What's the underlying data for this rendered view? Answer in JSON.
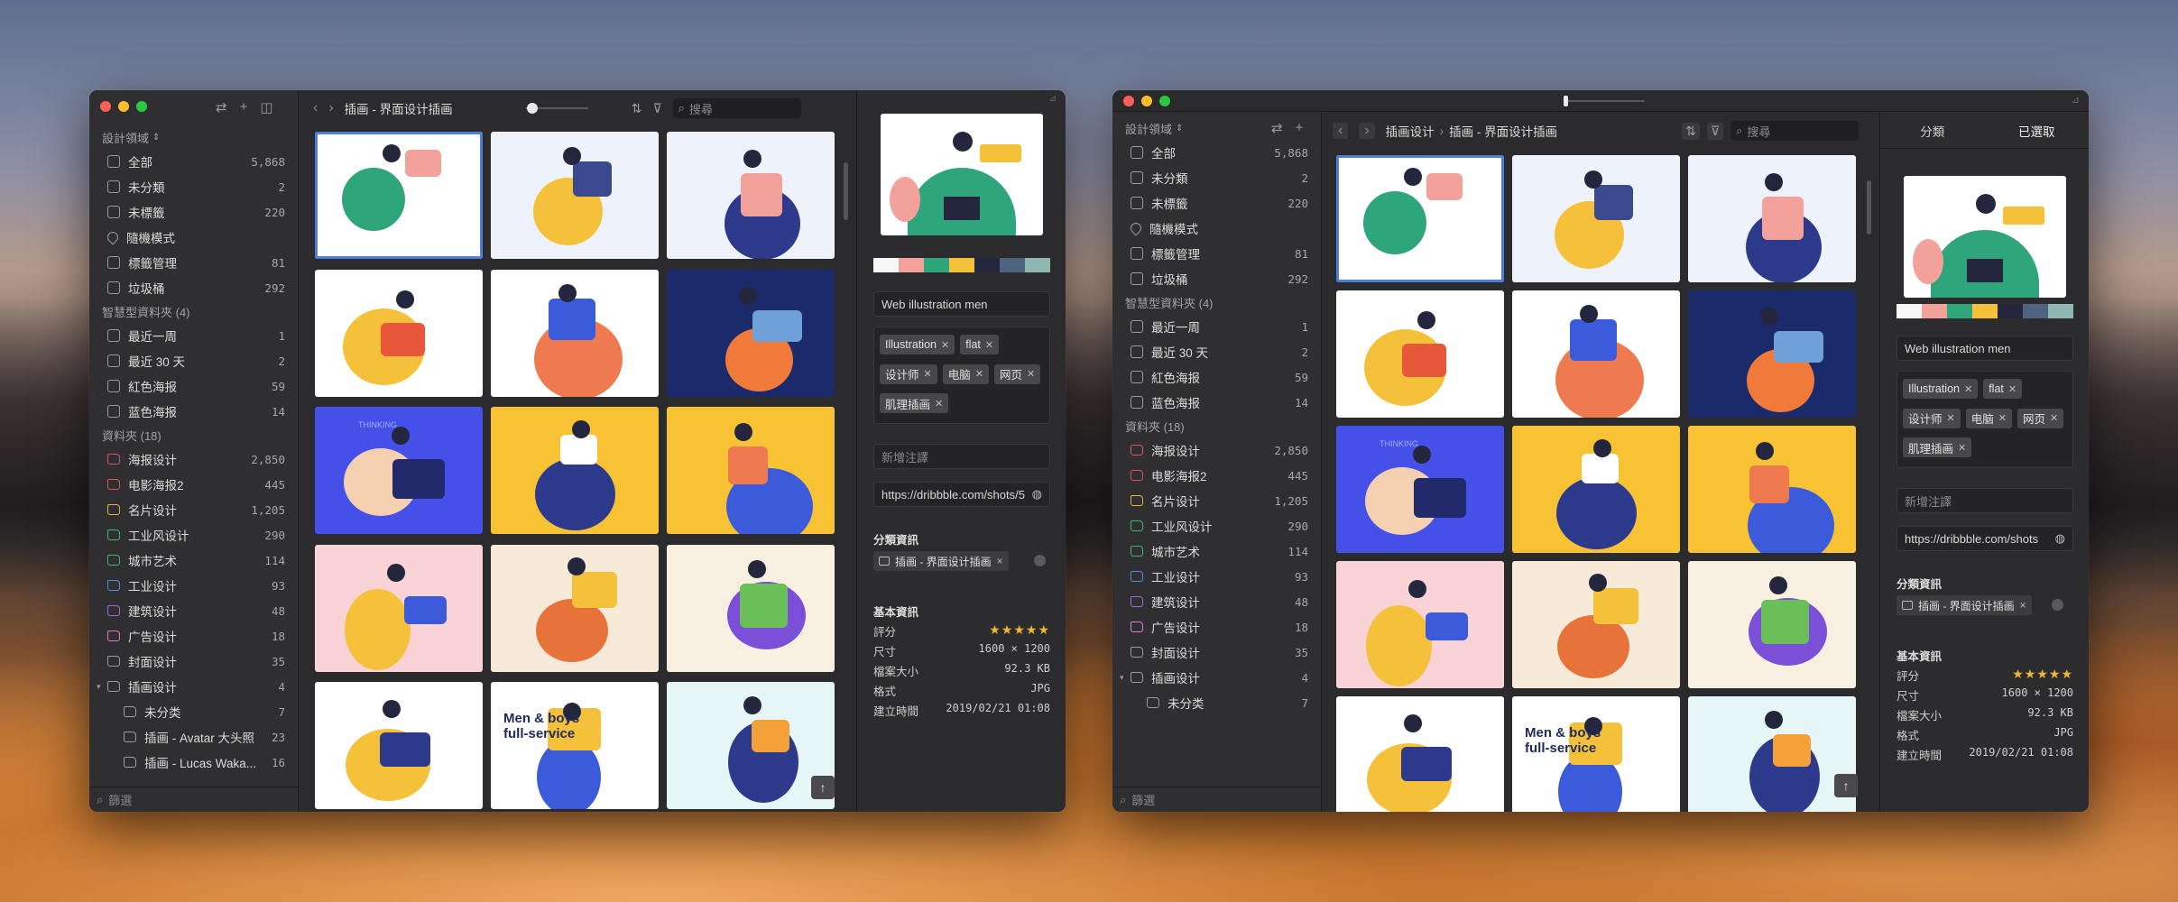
{
  "sidebar": {
    "library_name": "設計領域",
    "items": [
      {
        "label": "全部",
        "count": "5,868"
      },
      {
        "label": "未分類",
        "count": "2"
      },
      {
        "label": "未標籤",
        "count": "220"
      },
      {
        "label": "隨機模式",
        "count": ""
      },
      {
        "label": "標籤管理",
        "count": "81"
      },
      {
        "label": "垃圾桶",
        "count": "292"
      }
    ],
    "smart_folders_header": "智慧型資料夾 (4)",
    "smart_folders": [
      {
        "label": "最近一周",
        "count": "1"
      },
      {
        "label": "最近 30 天",
        "count": "2"
      },
      {
        "label": "紅色海报",
        "count": "59"
      },
      {
        "label": "蓝色海报",
        "count": "14"
      }
    ],
    "folders_header": "資料夾 (18)",
    "folders": [
      {
        "label": "海报设计",
        "count": "2,850",
        "color": "#e0505a"
      },
      {
        "label": "电影海报2",
        "count": "445",
        "color": "#e0505a"
      },
      {
        "label": "名片设计",
        "count": "1,205",
        "color": "#e8b43a"
      },
      {
        "label": "工业风设计",
        "count": "290",
        "color": "#3cbb6a"
      },
      {
        "label": "城市艺术",
        "count": "114",
        "color": "#3cbb6a"
      },
      {
        "label": "工业设计",
        "count": "93",
        "color": "#4a8fe0"
      },
      {
        "label": "建筑设计",
        "count": "48",
        "color": "#a06ae0"
      },
      {
        "label": "广告设计",
        "count": "18",
        "color": "#e07ad0"
      },
      {
        "label": "封面设计",
        "count": "35",
        "color": "#9d9d9f"
      },
      {
        "label": "插画设计",
        "count": "4",
        "color": "#9d9d9f"
      }
    ],
    "subfolders": [
      {
        "label": "未分类",
        "count": "7"
      },
      {
        "label": "插画 - Avatar 大头照",
        "count": "23"
      },
      {
        "label": "插画 - Lucas Waka...",
        "count": "16"
      }
    ],
    "filter_placeholder": "篩選"
  },
  "toolbar1": {
    "title": "插画 - 界面设计插画",
    "search_placeholder": "搜尋"
  },
  "toolbar2": {
    "breadcrumb_parent": "插画设计",
    "breadcrumb_sep": "›",
    "breadcrumb_current": "插画 - 界面设计插画",
    "search_placeholder": "搜尋"
  },
  "inspector": {
    "tabs": [
      "分類",
      "已選取"
    ],
    "palette": [
      "#f7f7f7",
      "#f2a19b",
      "#2fa57c",
      "#f5c13a",
      "#24263d",
      "#4e6380",
      "#8fb8b2"
    ],
    "name": "Web illustration men",
    "tags": [
      "Illustration",
      "flat",
      "设计师",
      "电脑",
      "网页",
      "肌理插画"
    ],
    "note_placeholder": "新增注譯",
    "url": "https://dribbble.com/shots/5",
    "url_short": "https://dribbble.com/shots",
    "category_title": "分類資訊",
    "category_value": "插画 - 界面设计插画",
    "basic_title": "基本資訊",
    "rows": [
      {
        "k": "評分",
        "v": "★★★★★",
        "rating": 5
      },
      {
        "k": "尺寸",
        "v": "1600 × 1200"
      },
      {
        "k": "檔案大小",
        "v": "92.3 KB"
      },
      {
        "k": "格式",
        "v": "JPG"
      },
      {
        "k": "建立時間",
        "v": "2019/02/21 01:08"
      }
    ]
  },
  "thumbs": [
    {
      "bg": "#ffffff",
      "a": "#2fa57c",
      "b": "#f2a19b",
      "selected": true
    },
    {
      "bg": "#eef3fb",
      "a": "#f5c13a",
      "b": "#3b4a8f"
    },
    {
      "bg": "#eef3fb",
      "a": "#2d3a8c",
      "b": "#f2a19b"
    },
    {
      "bg": "#ffffff",
      "a": "#f5c13a",
      "b": "#e8573a"
    },
    {
      "bg": "#ffffff",
      "a": "#f07a4f",
      "b": "#3b5bdb"
    },
    {
      "bg": "#1b2a6b",
      "a": "#f07a3a",
      "b": "#6fa0d8"
    },
    {
      "bg": "#4450e8",
      "a": "#f5d0b0",
      "b": "#222a6b",
      "text": "THINKING"
    },
    {
      "bg": "#f7c234",
      "a": "#2d3a8c",
      "b": "#ffffff"
    },
    {
      "bg": "#f7c234",
      "a": "#3b5bdb",
      "b": "#f07a4f"
    },
    {
      "bg": "#f9d3d6",
      "a": "#f5c13a",
      "b": "#3b5bdb"
    },
    {
      "bg": "#f7ead8",
      "a": "#e8733a",
      "b": "#f5c13a"
    },
    {
      "bg": "#f7f0e0",
      "a": "#7b4fd8",
      "b": "#6bbf59"
    },
    {
      "bg": "#ffffff",
      "a": "#f5c13a",
      "b": "#2d3a8c"
    },
    {
      "bg": "#ffffff",
      "a": "#3b5bdb",
      "b": "#f5c13a",
      "text": "Men & boys full-service"
    },
    {
      "bg": "#e6f6f6",
      "a": "#2d3a8c",
      "b": "#f5a13a"
    }
  ]
}
